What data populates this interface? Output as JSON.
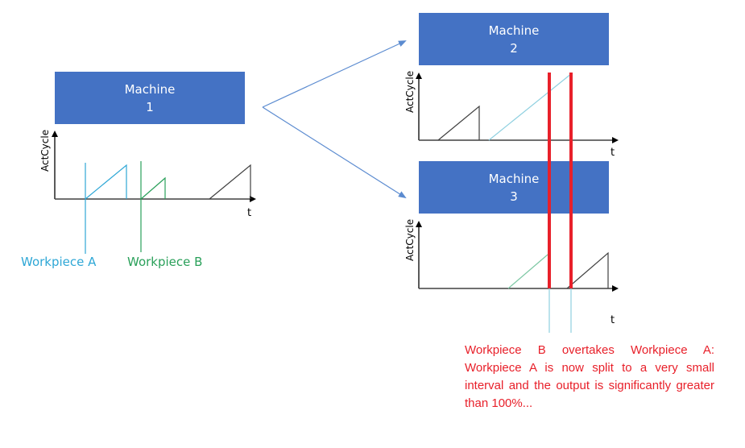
{
  "colors": {
    "machine_fill": "#4472c4",
    "workpiece_a": "#2ea7d6",
    "workpiece_b": "#2aa05a",
    "other_cycle": "#404040",
    "highlight": "#e8202a",
    "flow_arrow": "#5b8bd0"
  },
  "machines": [
    {
      "name": "Machine",
      "number": "1"
    },
    {
      "name": "Machine",
      "number": "2"
    },
    {
      "name": "Machine",
      "number": "3"
    }
  ],
  "charts": {
    "y_label": "ActCycle",
    "x_label": "t"
  },
  "workpiece_labels": {
    "a": "Workpiece A",
    "b": "Workpiece B"
  },
  "note": "Workpiece B overtakes Workpiece A: Workpiece A is now split to a very small interval and the output is significantly greater than 100%..."
}
